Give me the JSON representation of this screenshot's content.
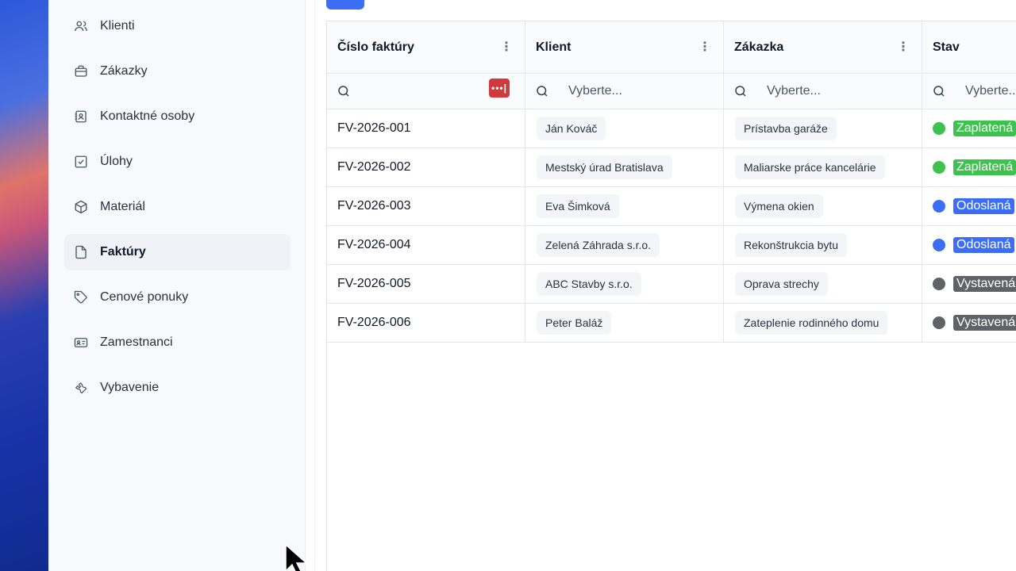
{
  "sidebar": {
    "items": [
      {
        "label": "Klienti",
        "icon": "users-icon",
        "active": false
      },
      {
        "label": "Zákazky",
        "icon": "briefcase-icon",
        "active": false
      },
      {
        "label": "Kontaktné osoby",
        "icon": "contact-book-icon",
        "active": false
      },
      {
        "label": "Úlohy",
        "icon": "checkbox-icon",
        "active": false
      },
      {
        "label": "Materiál",
        "icon": "box-icon",
        "active": false
      },
      {
        "label": "Faktúry",
        "icon": "file-icon",
        "active": true
      },
      {
        "label": "Cenové ponuky",
        "icon": "tag-icon",
        "active": false
      },
      {
        "label": "Zamestnanci",
        "icon": "id-card-icon",
        "active": false
      },
      {
        "label": "Vybavenie",
        "icon": "wrench-icon",
        "active": false
      }
    ]
  },
  "table": {
    "columns": [
      "Číslo faktúry",
      "Klient",
      "Zákazka",
      "Stav"
    ],
    "filter_placeholder": "Vyberte...",
    "password_badge": "•••|",
    "rows": [
      {
        "number": "FV-2026-001",
        "client": "Ján Kováč",
        "job": "Prístavba garáže",
        "status": "Zaplatená",
        "status_color": "#3cc24d"
      },
      {
        "number": "FV-2026-002",
        "client": "Mestský úrad Bratislava",
        "job": "Maliarske práce kancelárie",
        "status": "Zaplatená",
        "status_color": "#3cc24d"
      },
      {
        "number": "FV-2026-003",
        "client": "Eva Šimková",
        "job": "Výmena okien",
        "status": "Odoslaná",
        "status_color": "#3b6ef5"
      },
      {
        "number": "FV-2026-004",
        "client": "Zelená Záhrada s.r.o.",
        "job": "Rekonštrukcia bytu",
        "status": "Odoslaná",
        "status_color": "#3b6ef5"
      },
      {
        "number": "FV-2026-005",
        "client": "ABC Stavby s.r.o.",
        "job": "Oprava strechy",
        "status": "Vystavená",
        "status_color": "#5f6368"
      },
      {
        "number": "FV-2026-006",
        "client": "Peter Baláž",
        "job": "Zateplenie rodinného domu",
        "status": "Vystavená",
        "status_color": "#5f6368"
      }
    ]
  },
  "colors": {
    "accent": "#3b6ef5",
    "paid": "#3cc24d",
    "sent": "#3b6ef5",
    "issued": "#5f6368"
  }
}
